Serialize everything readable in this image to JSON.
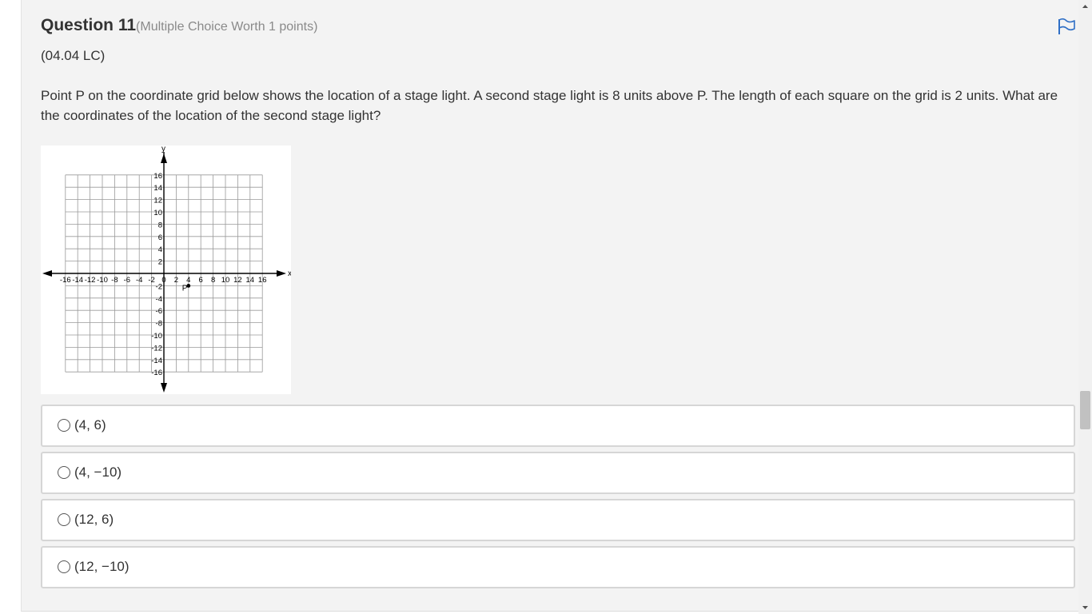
{
  "question": {
    "title": "Question 11",
    "meta": "(Multiple Choice Worth 1 points)",
    "code": "(04.04 LC)",
    "text": "Point P on the coordinate grid below shows the location of a stage light. A second stage light is 8 units above P. The length of each square on the grid is 2 units. What are the coordinates of the location of the second stage light?",
    "flag_icon": "flag-icon"
  },
  "graph": {
    "x_axis_label": "x",
    "y_axis_label": "y",
    "point_label": "P",
    "point": {
      "x": 4,
      "y": -2
    },
    "range": [
      -16,
      16
    ],
    "step": 2,
    "x_tick_labels": [
      "-16",
      "-14",
      "-12",
      "-10",
      "-8",
      "-6",
      "-4",
      "-2",
      "0",
      "2",
      "4",
      "6",
      "8",
      "10",
      "12",
      "14",
      "16"
    ],
    "y_tick_labels_positive": [
      "16",
      "14",
      "12",
      "10",
      "8",
      "6",
      "4",
      "2"
    ],
    "y_tick_labels_negative": [
      "-2",
      "-4",
      "-6",
      "-8",
      "-10",
      "-12",
      "-14",
      "-16"
    ]
  },
  "choices": [
    {
      "label": "(4, 6)"
    },
    {
      "label": "(4, −10)"
    },
    {
      "label": "(12, 6)"
    },
    {
      "label": "(12, −10)"
    }
  ],
  "colors": {
    "accent": "#2f6fc6",
    "card_background": "#f3f3f3",
    "choice_border": "#d6d6d6"
  }
}
